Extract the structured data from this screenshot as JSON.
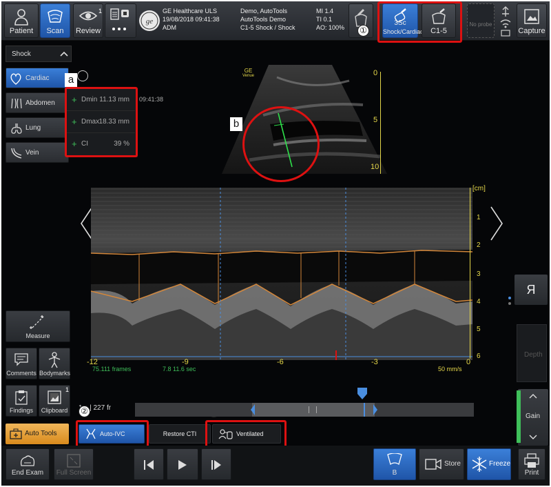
{
  "topbar": {
    "patient_label": "Patient",
    "scan_label": "Scan",
    "review_label": "Review",
    "review_count": "1",
    "brand": "GE Healthcare ULS",
    "datetime": "19/08/2018 09:41:38",
    "user": "ADM",
    "exam_name": "Demo, AutoTools",
    "exam_sub": "AutoTools Demo",
    "probe_preset": "C1-5  Shock / Shock",
    "mi": "MI 1.4",
    "ti": "TI 0.1",
    "ao": "AO: 100%",
    "probe_active_name": "3Sc",
    "probe_active_preset": "Shock/Cardiac",
    "probe2_name": "C1-5",
    "no_probe": "No probe",
    "capture_label": "Capture"
  },
  "annotations": {
    "circle1": "①",
    "circle2": "②",
    "circle3": "③",
    "a": "a",
    "b": "b"
  },
  "left": {
    "preset_group": "Shock",
    "presets": [
      "Cardiac",
      "Abdomen",
      "Lung",
      "Vein"
    ],
    "measure_label": "Measure",
    "comments_label": "Comments",
    "bodymarks_label": "Bodymarks",
    "findings_label": "Findings",
    "clipboard_label": "Clipboard",
    "clipboard_count": "1",
    "autotools_label": "Auto Tools"
  },
  "measurements": {
    "rows": [
      {
        "name": "Dmin",
        "value": "11.13 mm"
      },
      {
        "name": "Dmax",
        "value": "18.33 mm"
      },
      {
        "name": "CI",
        "value": "39 %"
      }
    ],
    "time": "09:41:38"
  },
  "image": {
    "ge_label": "GE",
    "ge_sub": "Venue",
    "depth_ticks": [
      "0",
      "5",
      "10"
    ],
    "mmode_unit": "[cm]",
    "mmode_ticks": [
      "1",
      "2",
      "3",
      "4",
      "5",
      "6"
    ],
    "x_ticks": [
      "-12",
      "-9",
      "-6",
      "-3",
      "0"
    ],
    "frames_info": "75.111 frames",
    "sec_info": "7.8 11.6 sec",
    "sweep_speed": "50 mm/s",
    "cine_info": "1 s | 227 fr"
  },
  "tools": {
    "auto_ivc": "Auto-IVC",
    "restore_cti": "Restore CTI",
    "ventilated": "Ventilated"
  },
  "right": {
    "r_label": "Я",
    "depth_label": "Depth",
    "gain_label": "Gain"
  },
  "bottom": {
    "end_exam": "End Exam",
    "full_screen": "Full Screen",
    "b_mode": "B",
    "store": "Store",
    "freeze": "Freeze",
    "print": "Print"
  },
  "colors": {
    "accent_blue": "#2a6ac8",
    "annotation_red": "#dd1111",
    "scale_yellow": "#e6d84a",
    "trace_orange": "#d4873a",
    "measure_green": "#3fbf5a",
    "caliper_green": "#2ee04a"
  }
}
